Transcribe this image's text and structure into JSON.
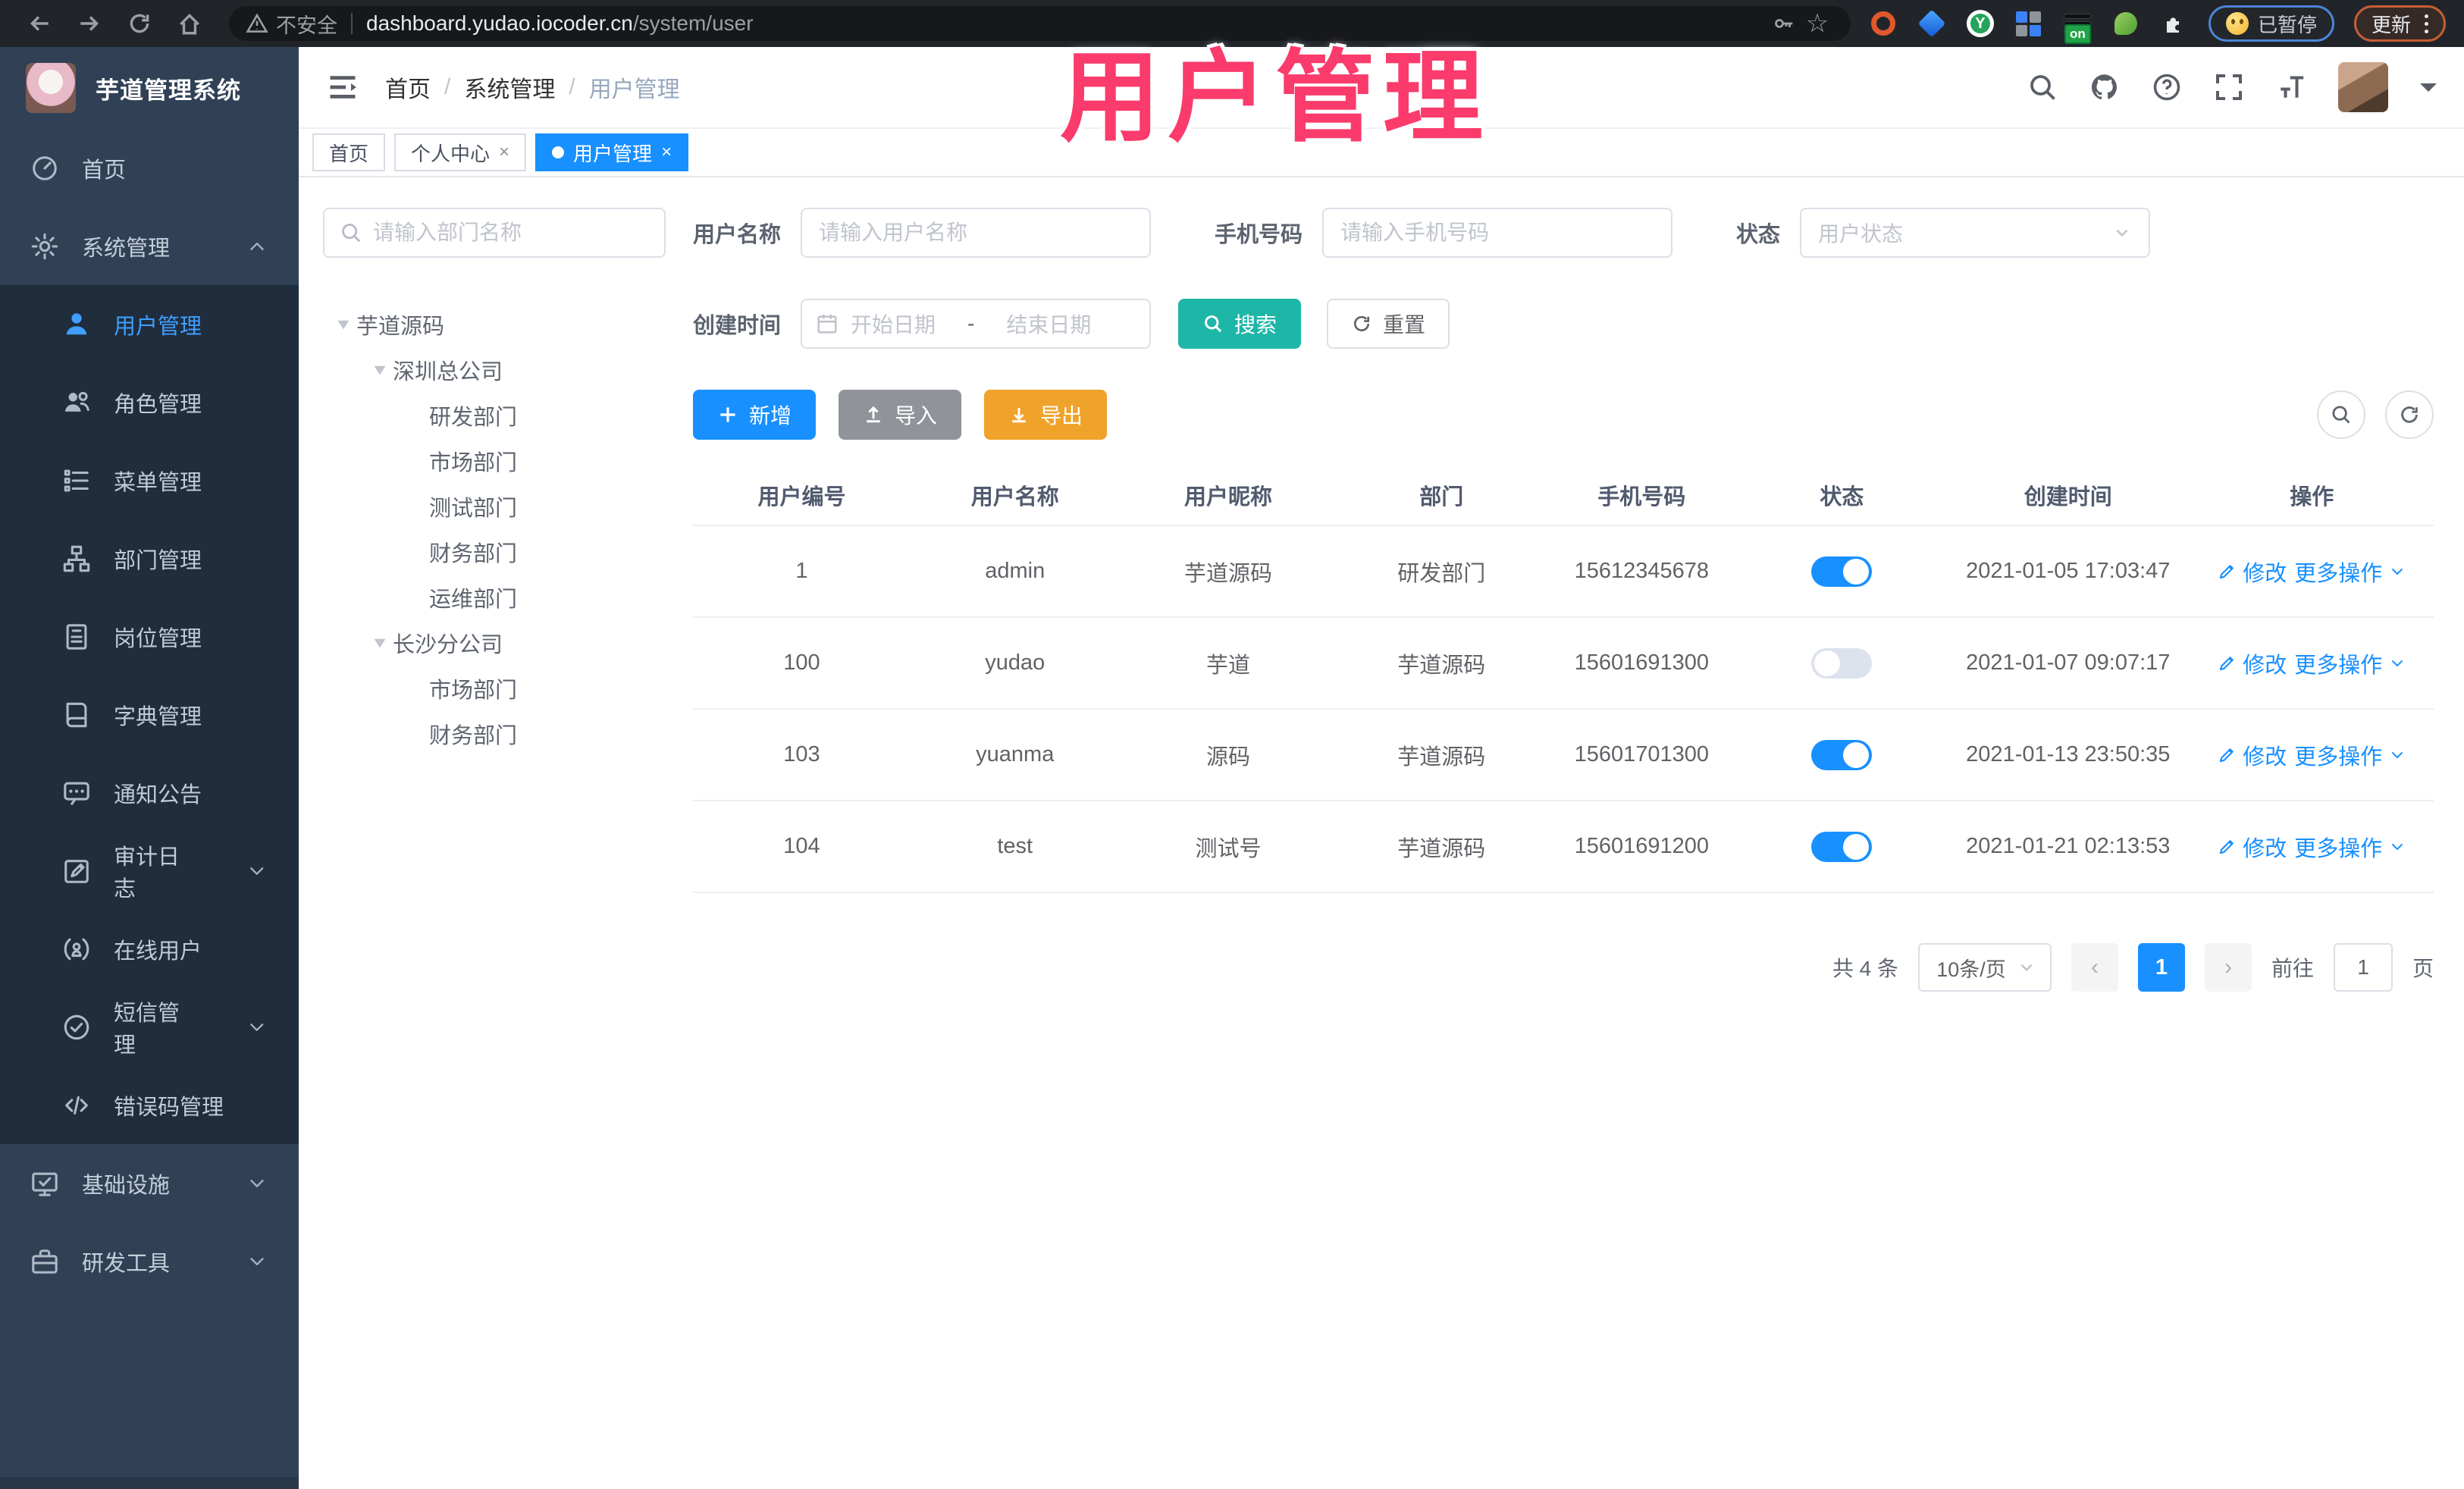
{
  "browser": {
    "security_label": "不安全",
    "url_host": "dashboard.yudao.iocoder.cn",
    "url_path": "/system/user",
    "ext_on_badge": "on",
    "paused_badge": "已暂停",
    "update_button": "更新",
    "bookmark_star": "☆"
  },
  "annotation": {
    "text": "用户管理",
    "color": "#fa3b6c"
  },
  "header": {
    "logo_title": "芋道管理系统",
    "breadcrumb": [
      "首页",
      "系统管理",
      "用户管理"
    ]
  },
  "tabs": [
    {
      "label": "首页",
      "active": false,
      "closable": false
    },
    {
      "label": "个人中心",
      "active": false,
      "closable": true
    },
    {
      "label": "用户管理",
      "active": true,
      "closable": true
    }
  ],
  "sidebar": {
    "items": [
      {
        "icon": "home",
        "label": "首页"
      },
      {
        "icon": "gear",
        "label": "系统管理",
        "arrow": "up"
      },
      {
        "icon": "user",
        "label": "用户管理",
        "sub": true,
        "active": true
      },
      {
        "icon": "users",
        "label": "角色管理",
        "sub": true
      },
      {
        "icon": "list",
        "label": "菜单管理",
        "sub": true
      },
      {
        "icon": "tree",
        "label": "部门管理",
        "sub": true
      },
      {
        "icon": "badge",
        "label": "岗位管理",
        "sub": true
      },
      {
        "icon": "book",
        "label": "字典管理",
        "sub": true
      },
      {
        "icon": "chat",
        "label": "通知公告",
        "sub": true
      },
      {
        "icon": "editlog",
        "label": "审计日志",
        "sub": true,
        "arrow": "down"
      },
      {
        "icon": "online",
        "label": "在线用户",
        "sub": true
      },
      {
        "icon": "check",
        "label": "短信管理",
        "sub": true,
        "arrow": "down"
      },
      {
        "icon": "code",
        "label": "错误码管理",
        "sub": true
      },
      {
        "icon": "monitor",
        "label": "基础设施",
        "arrow": "down"
      },
      {
        "icon": "tool",
        "label": "研发工具",
        "arrow": "down"
      }
    ]
  },
  "dept_panel": {
    "search_placeholder": "请输入部门名称",
    "nodes": [
      {
        "depth": 0,
        "caret": true,
        "label": "芋道源码"
      },
      {
        "depth": 1,
        "caret": true,
        "label": "深圳总公司"
      },
      {
        "depth": 2,
        "caret": false,
        "label": "研发部门"
      },
      {
        "depth": 2,
        "caret": false,
        "label": "市场部门"
      },
      {
        "depth": 2,
        "caret": false,
        "label": "测试部门"
      },
      {
        "depth": 2,
        "caret": false,
        "label": "财务部门"
      },
      {
        "depth": 2,
        "caret": false,
        "label": "运维部门"
      },
      {
        "depth": 1,
        "caret": true,
        "label": "长沙分公司"
      },
      {
        "depth": 2,
        "caret": false,
        "label": "市场部门"
      },
      {
        "depth": 2,
        "caret": false,
        "label": "财务部门"
      }
    ]
  },
  "filters": {
    "username_label": "用户名称",
    "username_placeholder": "请输入用户名称",
    "mobile_label": "手机号码",
    "mobile_placeholder": "请输入手机号码",
    "status_label": "状态",
    "status_placeholder": "用户状态",
    "date_label": "创建时间",
    "date_start": "开始日期",
    "date_sep": "-",
    "date_end": "结束日期",
    "search_label": "搜索",
    "reset_label": "重置"
  },
  "toolbar": {
    "add_label": "新增",
    "import_label": "导入",
    "export_label": "导出"
  },
  "table": {
    "columns": [
      "用户编号",
      "用户名称",
      "用户昵称",
      "部门",
      "手机号码",
      "状态",
      "创建时间",
      "操作"
    ],
    "edit_label": "修改",
    "more_label": "更多操作",
    "rows": [
      {
        "id": "1",
        "username": "admin",
        "nickname": "芋道源码",
        "dept": "研发部门",
        "mobile": "15612345678",
        "status": true,
        "created": "2021-01-05 17:03:47"
      },
      {
        "id": "100",
        "username": "yudao",
        "nickname": "芋道",
        "dept": "芋道源码",
        "mobile": "15601691300",
        "status": false,
        "created": "2021-01-07 09:07:17"
      },
      {
        "id": "103",
        "username": "yuanma",
        "nickname": "源码",
        "dept": "芋道源码",
        "mobile": "15601701300",
        "status": true,
        "created": "2021-01-13 23:50:35"
      },
      {
        "id": "104",
        "username": "test",
        "nickname": "测试号",
        "dept": "芋道源码",
        "mobile": "15601691200",
        "status": true,
        "created": "2021-01-21 02:13:53"
      }
    ]
  },
  "pagination": {
    "total_text": "共 4 条",
    "page_size": "10条/页",
    "current_page": "1",
    "goto_label": "前往",
    "goto_value": "1",
    "page_unit": "页"
  },
  "colors": {
    "primary": "#1890ff",
    "teal": "#1eb6a7",
    "warning": "#f0a32a",
    "gray_btn": "#909399",
    "annotation_pink": "#fa3b6c",
    "sidebar_bg": "#304156",
    "submenu_bg": "#1f2d3d"
  }
}
